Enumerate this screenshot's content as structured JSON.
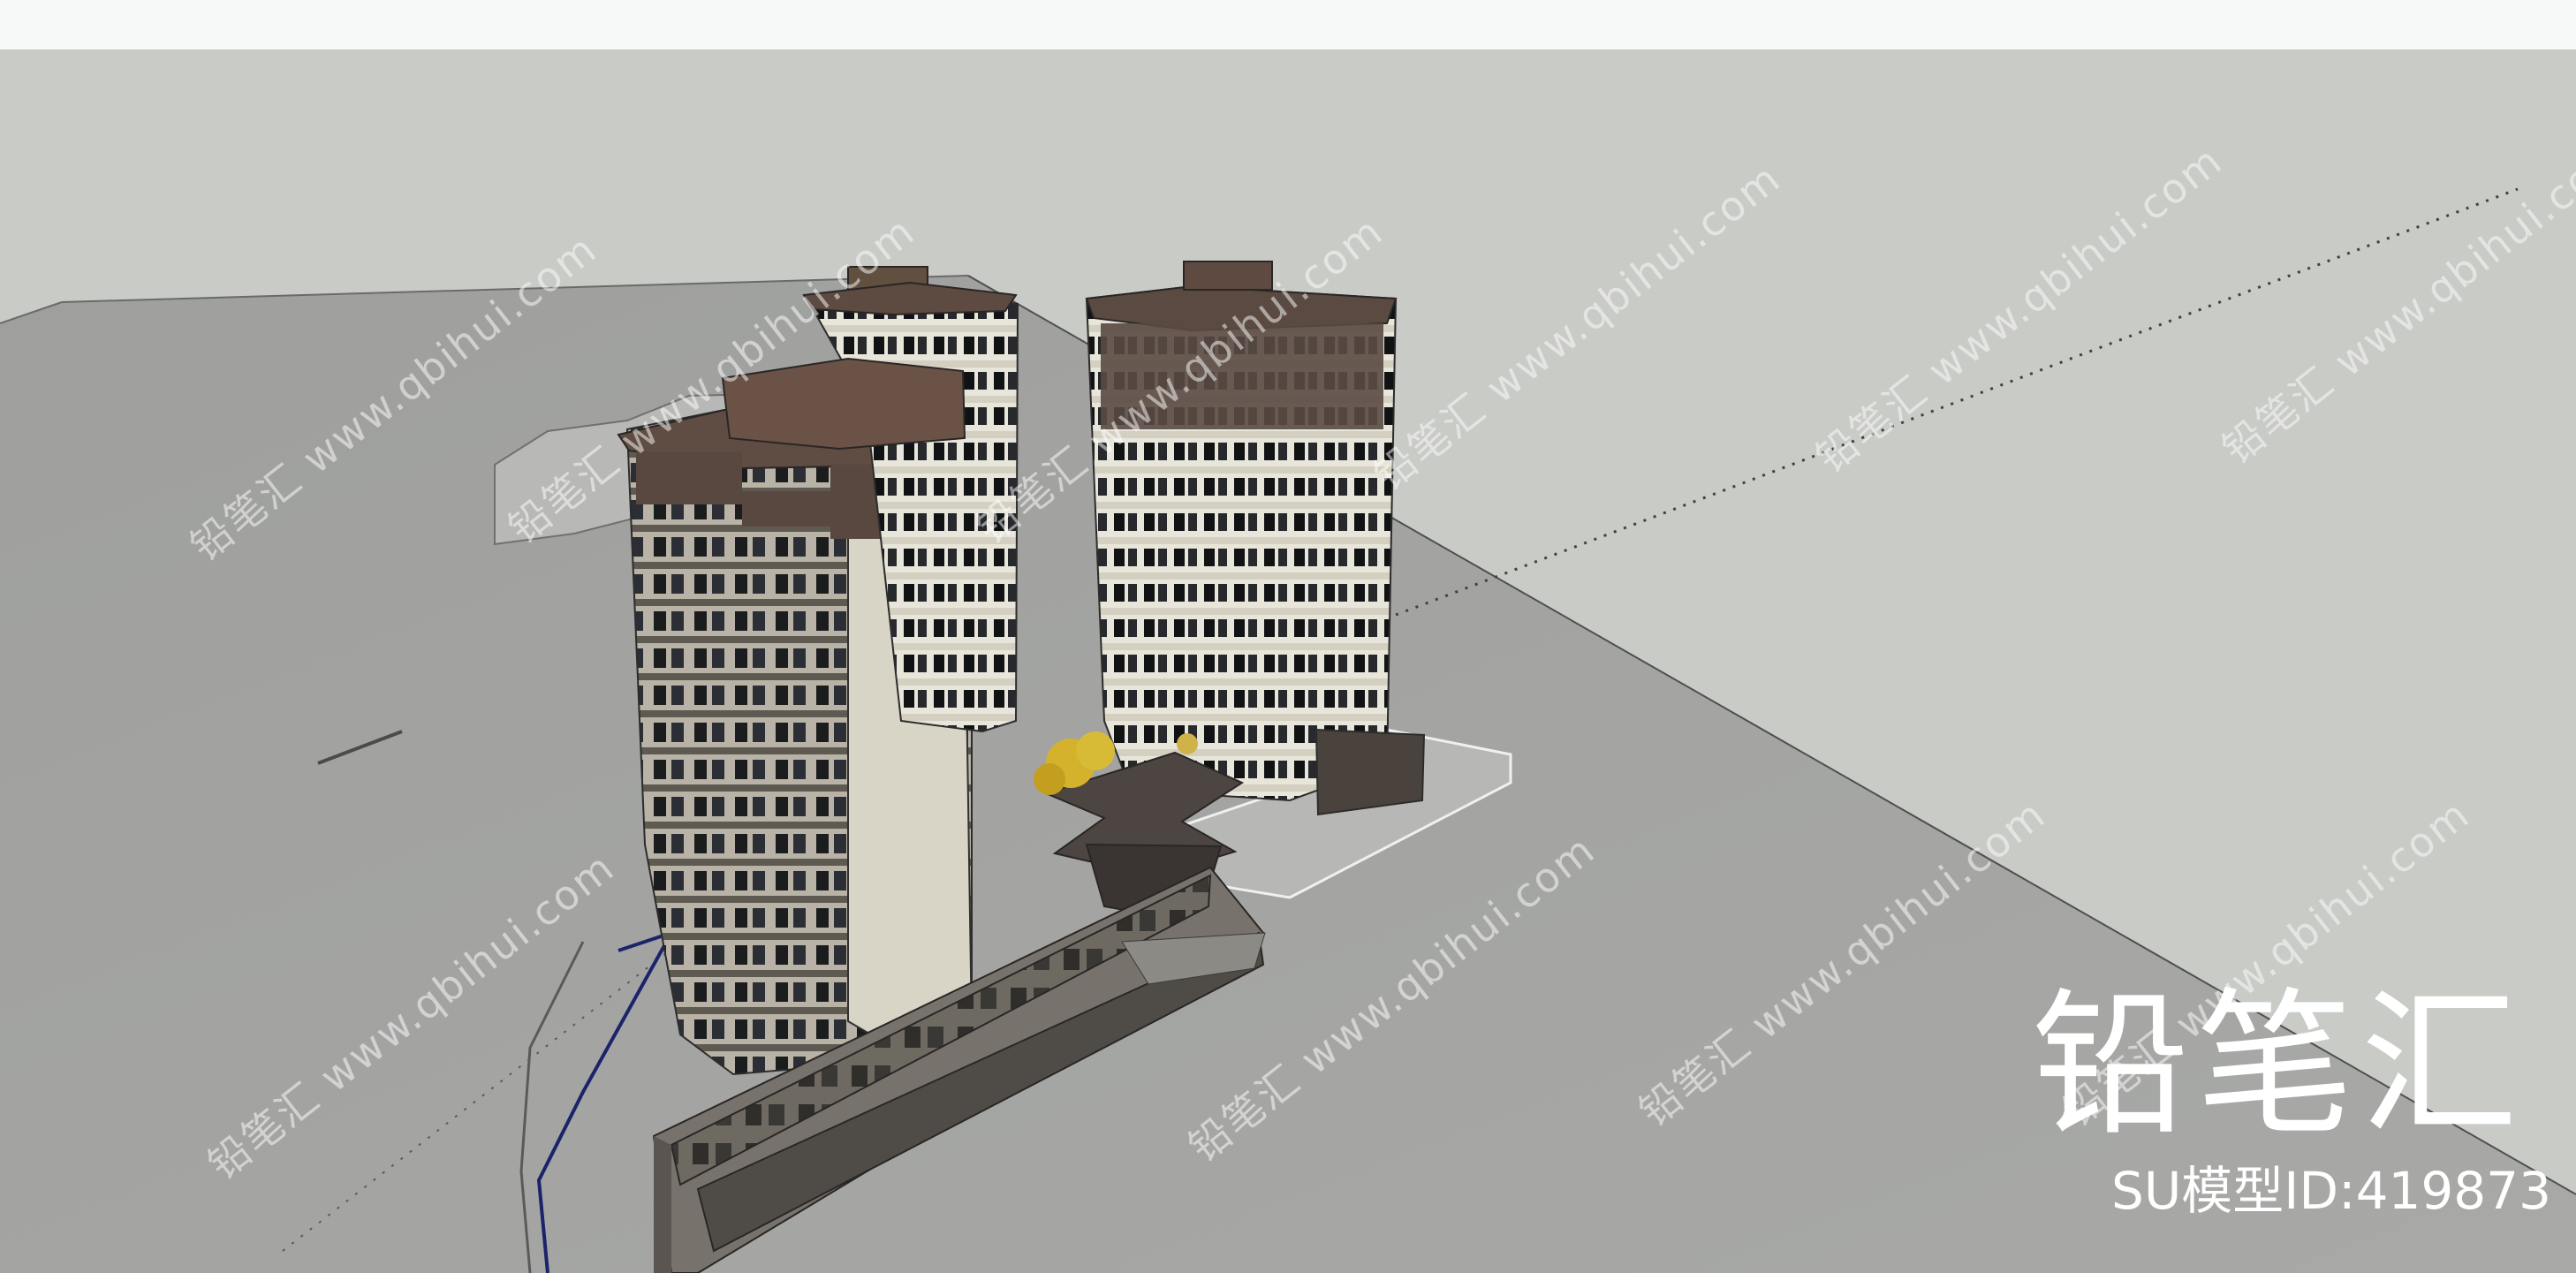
{
  "scene": {
    "background_color": "#c8cac6",
    "ground_color": "#a5a6a4",
    "toolbar_color": "#f7f8f8"
  },
  "brand": {
    "title": "铅笔汇",
    "subtitle": "SU模型ID:419873"
  },
  "watermark": {
    "text": "铅笔汇 www.qbihui.com"
  }
}
